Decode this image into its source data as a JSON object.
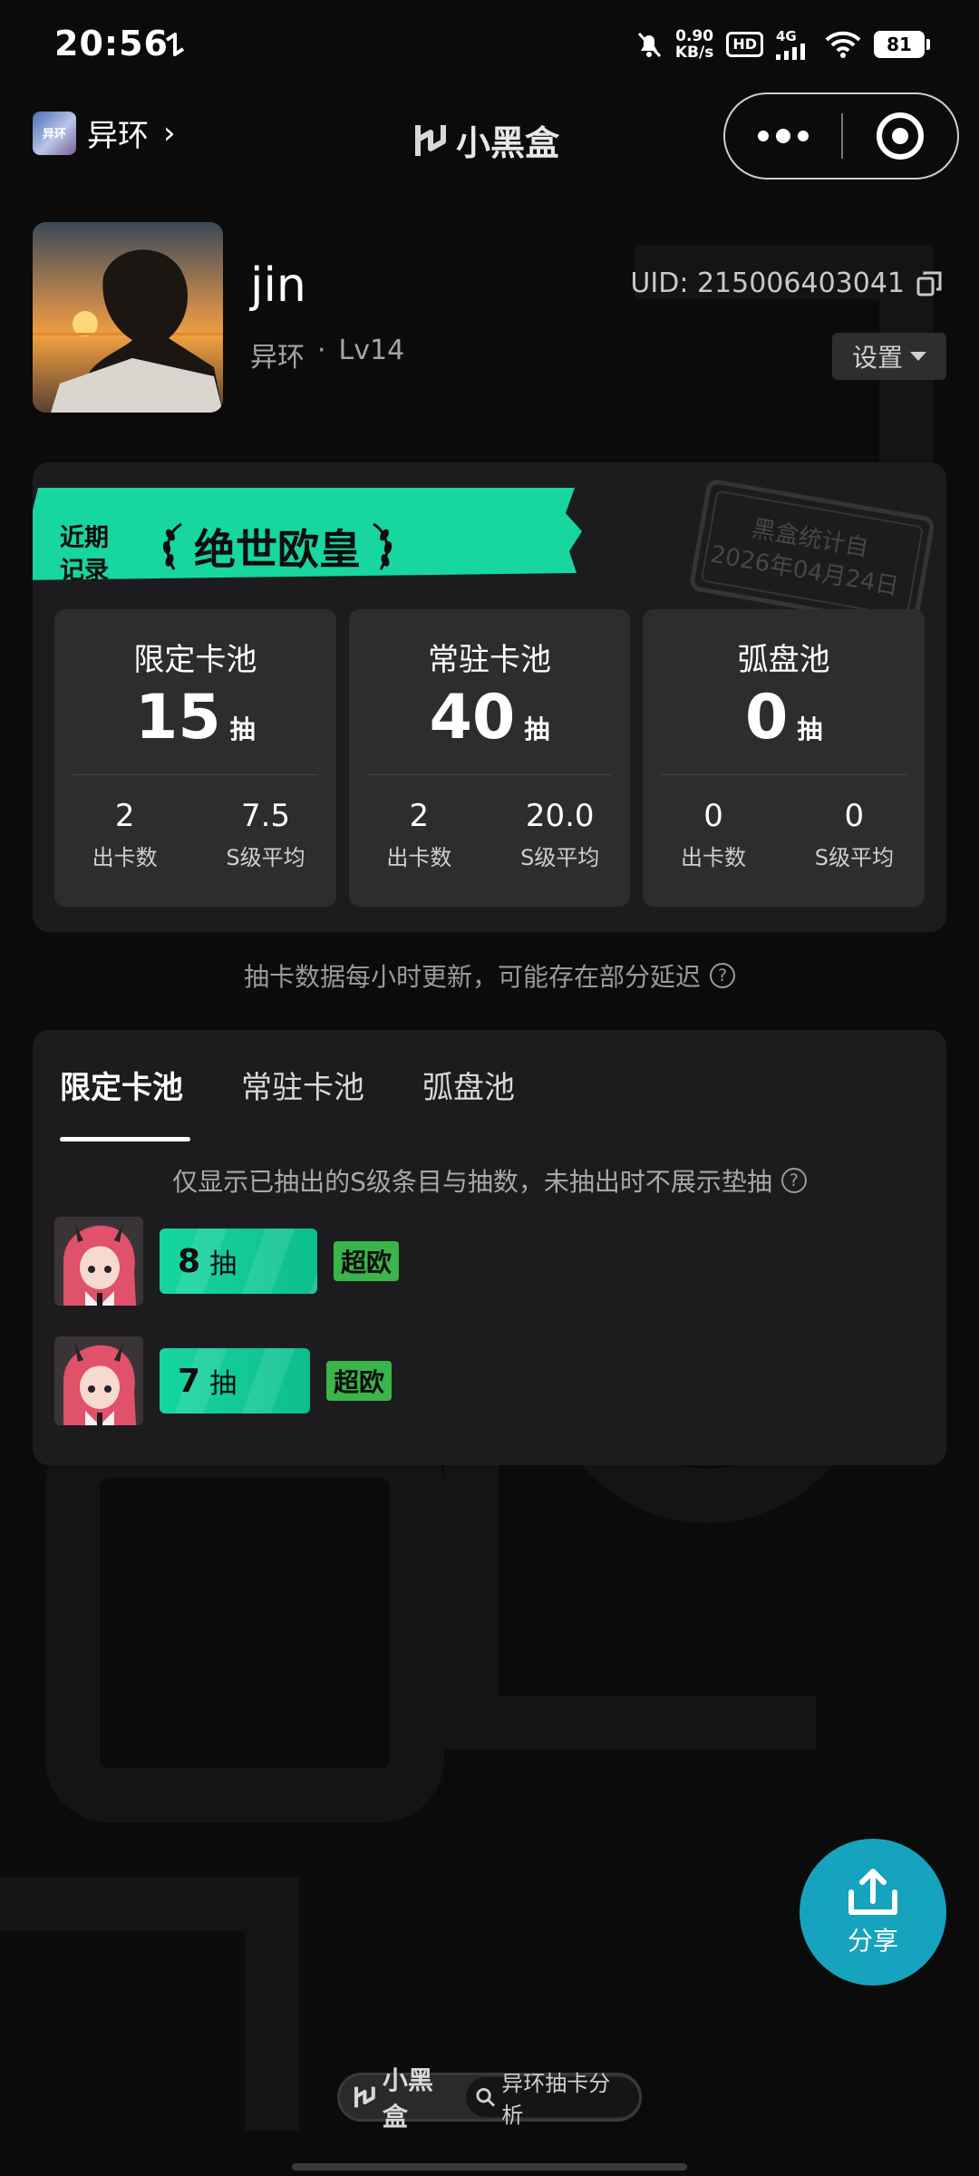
{
  "status_bar": {
    "time": "20:56",
    "speed_value": "0.90",
    "speed_unit": "KB/s",
    "hd": "HD",
    "network": "4G",
    "battery": "81"
  },
  "nav": {
    "game_icon_text": "异环",
    "game_name": "异环",
    "chevron": "›",
    "logo_text": "小黑盒"
  },
  "profile": {
    "username": "jin",
    "game": "异环",
    "separator": "·",
    "level": "Lv14",
    "uid": "UID: 215006403041",
    "settings_label": "设置"
  },
  "record": {
    "ribbon_line1": "近期",
    "ribbon_line2": "记录",
    "title": "绝世欧皇",
    "stamp_line1": "黑盒统计自",
    "stamp_line2": "2026年04月24日",
    "pools": [
      {
        "name": "限定卡池",
        "count": "15",
        "unit": "抽",
        "cards_value": "2",
        "cards_label": "出卡数",
        "avg_value": "7.5",
        "avg_label": "S级平均"
      },
      {
        "name": "常驻卡池",
        "count": "40",
        "unit": "抽",
        "cards_value": "2",
        "cards_label": "出卡数",
        "avg_value": "20.0",
        "avg_label": "S级平均"
      },
      {
        "name": "弧盘池",
        "count": "0",
        "unit": "抽",
        "cards_value": "0",
        "cards_label": "出卡数",
        "avg_value": "0",
        "avg_label": "S级平均"
      }
    ]
  },
  "notice": "抽卡数据每小时更新，可能存在部分延迟",
  "tabs": {
    "items": [
      "限定卡池",
      "常驻卡池",
      "弧盘池"
    ],
    "active_index": 0,
    "hint": "仅显示已抽出的S级条目与抽数，未抽出时不展示垫抽",
    "pulls": [
      {
        "count": "8",
        "unit": "抽",
        "tag": "超欧"
      },
      {
        "count": "7",
        "unit": "抽",
        "tag": "超欧"
      }
    ]
  },
  "share": {
    "label": "分享"
  },
  "footer": {
    "brand": "小黑盒",
    "search_text": "异环抽卡分析"
  },
  "colors": {
    "accent_green": "#17d6a0",
    "tag_green": "#3ab54a",
    "share_blue": "#16a3bd",
    "background": "#0b0b0c",
    "card": "#1c1c1e"
  }
}
